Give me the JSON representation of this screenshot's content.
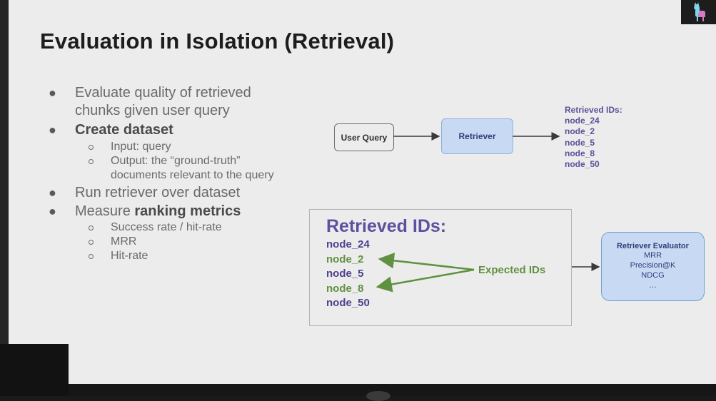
{
  "slide": {
    "title": "Evaluation in Isolation (Retrieval)",
    "bullets": {
      "b1_line1": "Evaluate quality of retrieved",
      "b1_line2": "chunks given user query",
      "b2": "Create dataset",
      "b2_sub1": "Input: query",
      "b2_sub2_line1": "Output: the “ground-truth”",
      "b2_sub2_line2": "documents relevant to the query",
      "b3": "Run retriever over dataset",
      "b4_prefix": "Measure ",
      "b4_bold": "ranking metrics",
      "b4_sub1": "Success rate / hit-rate",
      "b4_sub2": "MRR",
      "b4_sub3": "Hit-rate"
    },
    "diagram": {
      "user_query": "User Query",
      "retriever": "Retriever",
      "retrieved_ids_label": "Retrieved IDs:",
      "retrieved_ids": [
        "node_24",
        "node_2",
        "node_5",
        "node_8",
        "node_50"
      ],
      "box_title": "Retrieved IDs:",
      "expected_ids_label": "Expected IDs",
      "evaluator": {
        "title": "Retriever Evaluator",
        "metrics": [
          "MRR",
          "Precision@K",
          "NDCG",
          "…"
        ]
      }
    },
    "colors": {
      "background": "#ececec",
      "retriever_fill": "#c8daf3",
      "ids_purple": "#4f3f8e",
      "expected_green": "#5f9140"
    },
    "logo_icon": "llama-icon"
  }
}
